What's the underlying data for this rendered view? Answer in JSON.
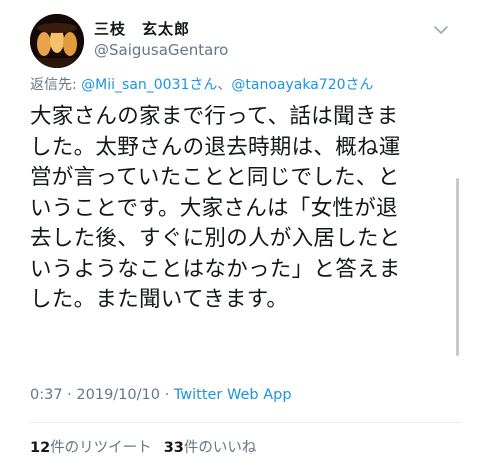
{
  "tweet": {
    "display_name": "三枝　玄太郎",
    "handle": "@SaigusaGentaro",
    "reply": {
      "prefix": "返信先: ",
      "mention1": "@Mii_san_0031さん",
      "separator": "、",
      "mention2": "@tanoayaka720さん"
    },
    "text": "大家さんの家まで行って、話は聞きま\nした。太野さんの退去時期は、概ね運\n営が言っていたことと同じでした、と\nいうことです。大家さんは「女性が退\n去した後、すぐに別の人が入居したと\nいうようなことはなかった」と答えま\nした。また聞いてきます。",
    "time": "0:37 · 2019/10/10 · ",
    "app": "Twitter Web App",
    "retweet_count": "12",
    "retweet_label": "件のリツイート",
    "like_count": "33",
    "like_label": "件のいいね"
  },
  "icons": {
    "avatar": "avatar-image",
    "menu": "chevron-down-icon"
  },
  "colors": {
    "link": "#1b95e0",
    "secondary": "#657786",
    "text": "#14171a"
  }
}
